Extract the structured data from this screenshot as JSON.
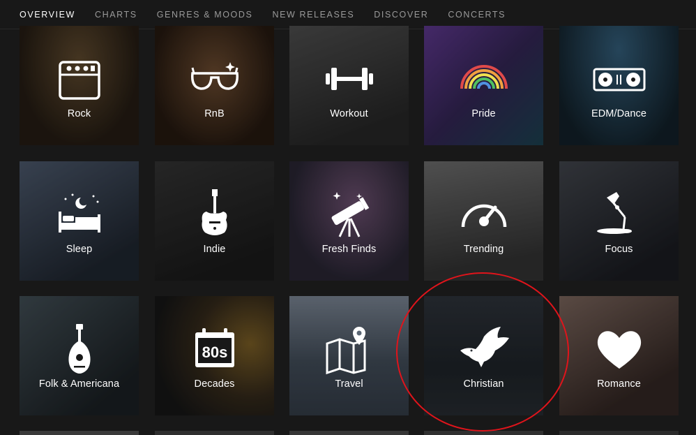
{
  "tabs": [
    {
      "label": "OVERVIEW",
      "active": true
    },
    {
      "label": "CHARTS",
      "active": false
    },
    {
      "label": "GENRES & MOODS",
      "active": false
    },
    {
      "label": "NEW RELEASES",
      "active": false
    },
    {
      "label": "DISCOVER",
      "active": false
    },
    {
      "label": "CONCERTS",
      "active": false
    }
  ],
  "genres": [
    {
      "label": "Rock",
      "icon": "amplifier-icon",
      "bg": "#3b2f22"
    },
    {
      "label": "RnB",
      "icon": "sunglasses-icon",
      "bg": "#3c2a1c"
    },
    {
      "label": "Workout",
      "icon": "dumbbell-icon",
      "bg": "#3a3a3a"
    },
    {
      "label": "Pride",
      "icon": "rainbow-icon",
      "bg": "#5a3a7a"
    },
    {
      "label": "EDM/Dance",
      "icon": "turntables-icon",
      "bg": "#1f3f52"
    },
    {
      "label": "Sleep",
      "icon": "bed-icon",
      "bg": "#2e3a4a"
    },
    {
      "label": "Indie",
      "icon": "guitar-icon",
      "bg": "#2c2c2c"
    },
    {
      "label": "Fresh Finds",
      "icon": "telescope-icon",
      "bg": "#4a3a4e"
    },
    {
      "label": "Trending",
      "icon": "gauge-icon",
      "bg": "#5a5a5a"
    },
    {
      "label": "Focus",
      "icon": "desk-lamp-icon",
      "bg": "#33363c"
    },
    {
      "label": "Folk & Americana",
      "icon": "mandolin-icon",
      "bg": "#2a3a3e"
    },
    {
      "label": "Decades",
      "icon": "calendar-80s-icon",
      "bg": "#3a3226"
    },
    {
      "label": "Travel",
      "icon": "map-pin-icon",
      "bg": "#5c6a78"
    },
    {
      "label": "Christian",
      "icon": "dove-icon",
      "bg": "#2b3036"
    },
    {
      "label": "Romance",
      "icon": "heart-icon",
      "bg": "#4a3a36"
    }
  ],
  "colors": {
    "accent": "#1db954",
    "annotation": "#e0141b"
  }
}
